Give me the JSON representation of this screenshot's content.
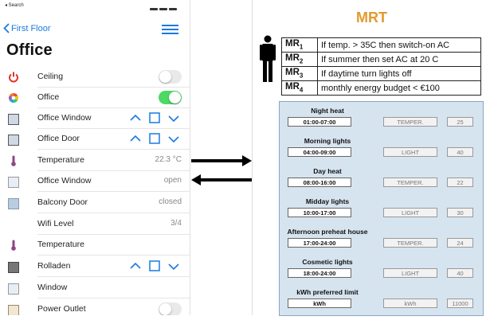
{
  "status": {
    "back_text": "◂ Search"
  },
  "nav": {
    "back_label": "First Floor"
  },
  "page": {
    "title": "Office"
  },
  "rows": [
    {
      "icon": "power-icon",
      "label": "Ceiling",
      "control": "toggle-off"
    },
    {
      "icon": "color-wheel-icon",
      "label": "Office",
      "control": "toggle-on"
    },
    {
      "icon": "window-icon",
      "label": "Office Window",
      "control": "blind-controls"
    },
    {
      "icon": "door-icon",
      "label": "Office Door",
      "control": "blind-controls"
    },
    {
      "icon": "thermometer-icon",
      "label": "Temperature",
      "value": "22.3 °C"
    },
    {
      "icon": "window-open-icon",
      "label": "Office Window",
      "value": "open"
    },
    {
      "icon": "balcony-door-icon",
      "label": "Balcony Door",
      "value": "closed"
    },
    {
      "icon": "",
      "label": "Wifi Level",
      "value": "3/4"
    },
    {
      "icon": "thermometer-icon",
      "label": "Temperature"
    },
    {
      "icon": "rollershutter-icon",
      "label": "Rolladen",
      "control": "blind-controls"
    },
    {
      "icon": "window-icon",
      "label": "Window"
    },
    {
      "icon": "power-outlet-icon",
      "label": "Power Outlet",
      "control": "toggle-off"
    }
  ],
  "mrt": {
    "title": "MRT",
    "rules": [
      {
        "id": "MR",
        "sub": "1",
        "text": "If temp. > 35C then switch-on AC"
      },
      {
        "id": "MR",
        "sub": "2",
        "text": "If summer then set AC at 20 C"
      },
      {
        "id": "MR",
        "sub": "3",
        "text": "If daytime turn lights off"
      },
      {
        "id": "MR",
        "sub": "4",
        "text": "monthly energy budget < €100"
      }
    ],
    "schedules": [
      {
        "name": "Night heat",
        "time": "01:00-07:00",
        "type": "TEMPER.",
        "value": "25"
      },
      {
        "name": "Morning lights",
        "time": "04:00-09:00",
        "type": "LIGHT",
        "value": "40"
      },
      {
        "name": "Day heat",
        "time": "08:00-16:00",
        "type": "TEMPER.",
        "value": "22"
      },
      {
        "name": "Midday lights",
        "time": "10:00-17:00",
        "type": "LIGHT",
        "value": "30"
      },
      {
        "name": "Afternoon preheat house",
        "time": "17:00-24:00",
        "type": "TEMPER.",
        "value": "24"
      },
      {
        "name": "Cosmetic lights",
        "time": "18:00-24:00",
        "type": "LIGHT",
        "value": "40"
      },
      {
        "name": "kWh preferred limit",
        "time": "kWh",
        "type": "kWh",
        "value": "11000"
      }
    ]
  },
  "colors": {
    "accent": "#1a7ae0",
    "toggle_on": "#4cd964",
    "mrt_title": "#e39a2d",
    "panel_bg": "#d6e4f0"
  }
}
